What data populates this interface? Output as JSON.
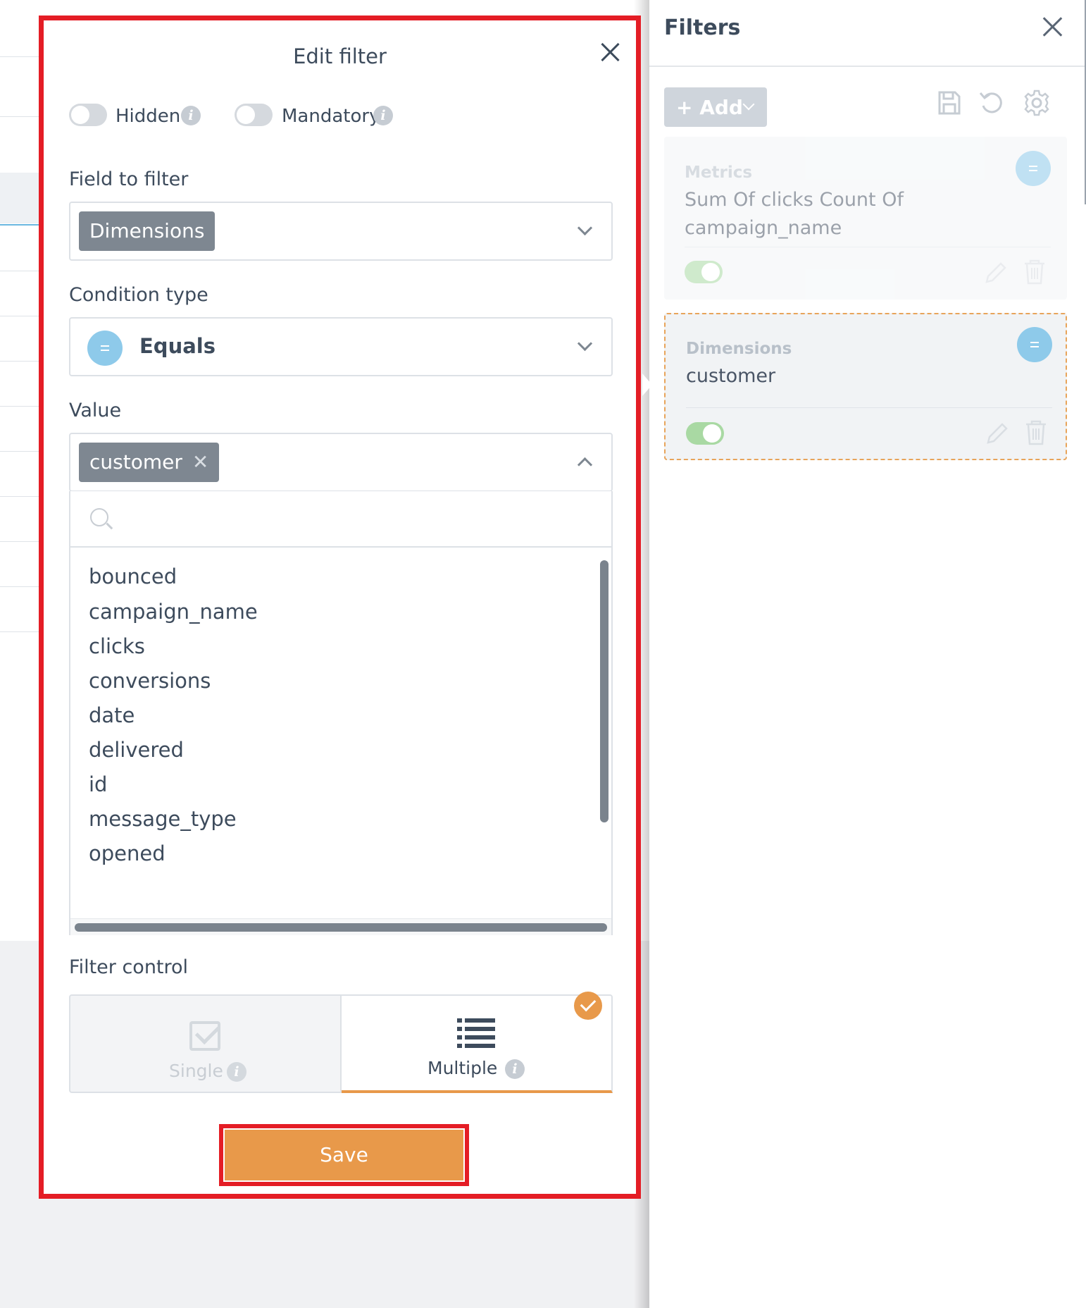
{
  "filters_panel": {
    "title": "Filters",
    "add_label": "+ Add",
    "icons": [
      "save-icon",
      "undo-icon",
      "gear-icon"
    ],
    "cards": [
      {
        "category": "Metrics",
        "text_line1": "Sum Of clicks Count Of",
        "text_line2": "campaign_name",
        "enabled": true
      },
      {
        "category": "Dimensions",
        "text_line1": "customer",
        "enabled": true
      }
    ]
  },
  "edit_filter": {
    "title": "Edit filter",
    "hidden_label": "Hidden",
    "mandatory_label": "Mandatory",
    "info_glyph": "i",
    "field_label": "Field to filter",
    "field_value": "Dimensions",
    "condition_label": "Condition type",
    "condition_value": "Equals",
    "value_label": "Value",
    "value_chip": "customer",
    "chip_remove_glyph": "✕",
    "search_placeholder": "",
    "options": [
      "bounced",
      "campaign_name",
      "clicks",
      "conversions",
      "date",
      "delivered",
      "id",
      "message_type",
      "opened"
    ],
    "filter_control_label": "Filter control",
    "single_label": "Single",
    "multiple_label": "Multiple",
    "selected_control": "Multiple",
    "save_label": "Save"
  },
  "colors": {
    "accent_orange": "#e8994a",
    "highlight_red": "#e41d25",
    "badge_blue": "#8ecaea",
    "toggle_green": "#a9d9a3",
    "chip_gray": "#7e8791"
  }
}
